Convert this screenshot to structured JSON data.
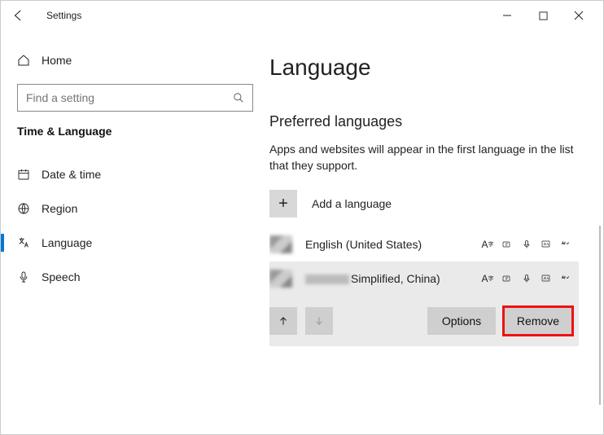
{
  "titlebar": {
    "title": "Settings"
  },
  "sidebar": {
    "home_label": "Home",
    "search_placeholder": "Find a setting",
    "section_label": "Time & Language",
    "items": [
      {
        "label": "Date & time"
      },
      {
        "label": "Region"
      },
      {
        "label": "Language"
      },
      {
        "label": "Speech"
      }
    ]
  },
  "main": {
    "heading": "Language",
    "section_heading": "Preferred languages",
    "description": "Apps and websites will appear in the first language in the list that they support.",
    "add_label": "Add a language",
    "languages": [
      {
        "name": "English (United States)"
      },
      {
        "name_suffix": "Simplified, China)"
      }
    ],
    "actions": {
      "options": "Options",
      "remove": "Remove"
    }
  }
}
